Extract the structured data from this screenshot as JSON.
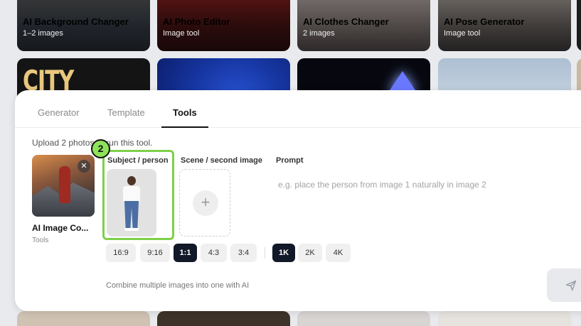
{
  "gallery": {
    "tiles": [
      {
        "title": "AI Background Changer",
        "subtitle": "1–2 images"
      },
      {
        "title": "AI Photo Editor",
        "subtitle": "Image tool"
      },
      {
        "title": "AI Clothes Changer",
        "subtitle": "2 images"
      },
      {
        "title": "AI Pose Generator",
        "subtitle": "Image tool"
      }
    ],
    "poster_text": "CITY NIGHTS"
  },
  "panel": {
    "tabs": [
      {
        "label": "Generator",
        "active": false
      },
      {
        "label": "Template",
        "active": false
      },
      {
        "label": "Tools",
        "active": true
      }
    ],
    "hint": "Upload 2 photos to run this tool.",
    "selected_tool": {
      "name": "AI Image Co...",
      "category": "Tools",
      "remove_icon": "close-icon"
    },
    "step_badge": "2",
    "slots": {
      "subject_label": "Subject / person",
      "scene_label": "Scene / second image",
      "scene_icon": "plus-icon"
    },
    "prompt": {
      "label": "Prompt",
      "placeholder": "e.g. place the person from image 1 naturally in image 2",
      "value": ""
    },
    "aspect_ratios": [
      {
        "label": "16:9",
        "active": false
      },
      {
        "label": "9:16",
        "active": false
      },
      {
        "label": "1:1",
        "active": true
      },
      {
        "label": "4:3",
        "active": false
      },
      {
        "label": "3:4",
        "active": false
      }
    ],
    "resolutions": [
      {
        "label": "1K",
        "active": true
      },
      {
        "label": "2K",
        "active": false
      },
      {
        "label": "4K",
        "active": false
      }
    ],
    "footer_note": "Combine multiple images into one with AI",
    "send_icon": "send-icon"
  },
  "colors": {
    "accent_highlight": "#8ee35a",
    "active_chip": "#111827"
  }
}
